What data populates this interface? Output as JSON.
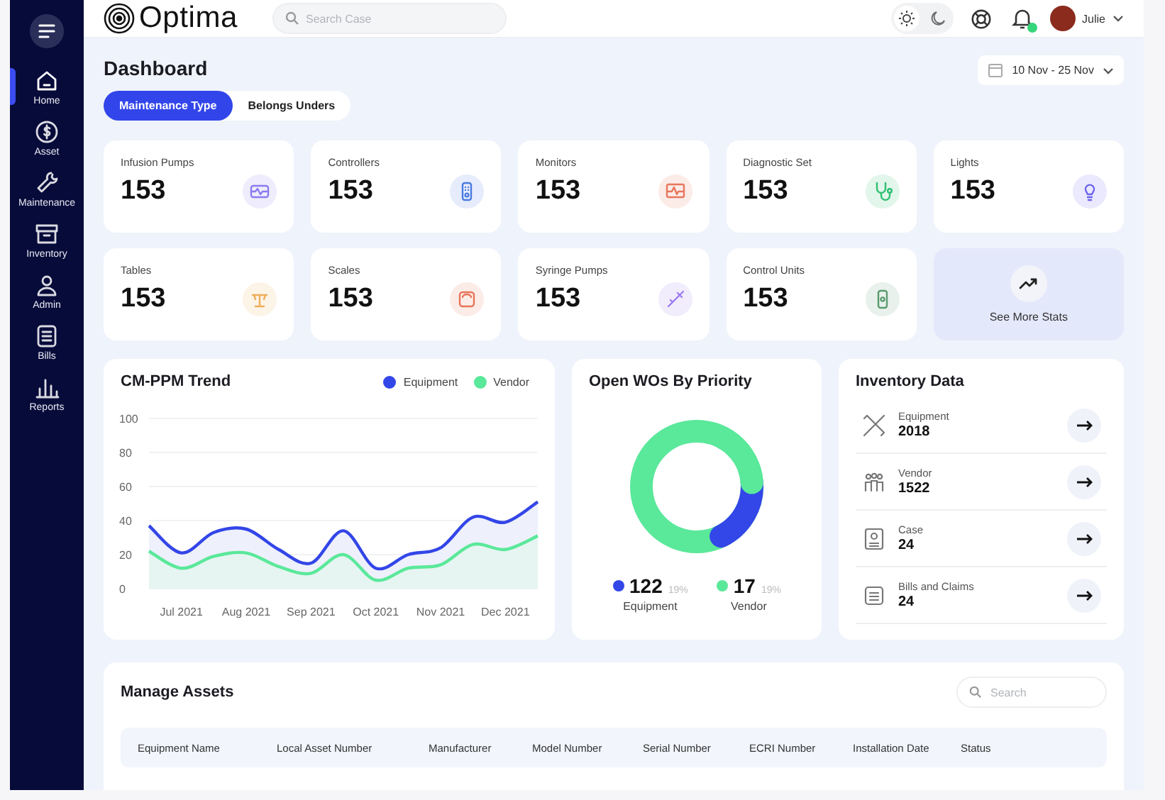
{
  "sidebar": {
    "items": [
      {
        "label": "Home",
        "selected": true
      },
      {
        "label": "Asset",
        "selected": false
      },
      {
        "label": "Maintenance",
        "selected": false
      },
      {
        "label": "Inventory",
        "selected": false
      },
      {
        "label": "Admin",
        "selected": false
      },
      {
        "label": "Bills",
        "selected": false
      },
      {
        "label": "Reports",
        "selected": false
      }
    ]
  },
  "header": {
    "logo": "Optima",
    "search": {
      "placeholder": "Search Case"
    },
    "theme_options": [
      {
        "selected": true
      },
      {
        "selected": false
      }
    ],
    "user": {
      "name": "Julie"
    }
  },
  "dashboard": {
    "title": "Dashboard",
    "date_range": "10 Nov - 25 Nov",
    "tabs": [
      {
        "label": "Maintenance Type",
        "selected": true
      },
      {
        "label": "Belongs Unders",
        "selected": false
      }
    ]
  },
  "stats": [
    {
      "label": "Infusion Pumps",
      "value": "153",
      "color": "#8a7cf0"
    },
    {
      "label": "Controllers",
      "value": "153",
      "color": "#4a7ae0"
    },
    {
      "label": "Monitors",
      "value": "153",
      "color": "#e8765c"
    },
    {
      "label": "Diagnostic Set",
      "value": "153",
      "color": "#2fbf71"
    },
    {
      "label": "Lights",
      "value": "153",
      "color": "#6c63f0"
    },
    {
      "label": "Tables",
      "value": "153",
      "color": "#eeae5a"
    },
    {
      "label": "Scales",
      "value": "153",
      "color": "#e8745a"
    },
    {
      "label": "Syringe Pumps",
      "value": "153",
      "color": "#9d7cf2"
    },
    {
      "label": "Control Units",
      "value": "153",
      "color": "#5a9a6e"
    }
  ],
  "see_more": "See More Stats",
  "trend": {
    "title": "CM-PPM Trend",
    "chart_data": {
      "type": "line",
      "categories": [
        null,
        "Jul 2021",
        null,
        "Aug 2021",
        null,
        "Sep 2021",
        null,
        "Oct 2021",
        null,
        "Nov 2021",
        null,
        "Dec 2021",
        null
      ],
      "ylim": [
        0,
        100
      ],
      "grid": true,
      "yticks": [
        0,
        20,
        40,
        60,
        80,
        100
      ],
      "series": [
        {
          "name": "Equipment",
          "color": "#3346e8",
          "values": [
            37,
            21,
            33,
            35,
            23,
            15,
            34,
            12,
            20,
            24,
            42,
            39,
            51
          ]
        },
        {
          "name": "Vendor",
          "color": "#5ae89a",
          "values": [
            22,
            12,
            19,
            21,
            13,
            9,
            20,
            5,
            12,
            14,
            26,
            23,
            31
          ]
        }
      ]
    }
  },
  "wos": {
    "title": "Open WOs By Priority",
    "legend": [
      {
        "value": "122",
        "percent": "19%",
        "label": "Equipment",
        "color": "#3346e8"
      },
      {
        "value": "17",
        "percent": "19%",
        "label": "Vendor",
        "color": "#5ae89a"
      }
    ]
  },
  "inventory": {
    "title": "Inventory Data",
    "items": [
      {
        "label": "Equipment",
        "value": "2018"
      },
      {
        "label": "Vendor",
        "value": "1522"
      },
      {
        "label": "Case",
        "value": "24"
      },
      {
        "label": "Bills and Claims",
        "value": "24"
      }
    ]
  },
  "assets": {
    "title": "Manage Assets",
    "search": {
      "placeholder": "Search"
    },
    "columns": [
      "Equipment Name",
      "Local Asset Number",
      "Manufacturer",
      "Model Number",
      "Serial Number",
      "ECRI Number",
      "Installation Date",
      "Status"
    ]
  }
}
